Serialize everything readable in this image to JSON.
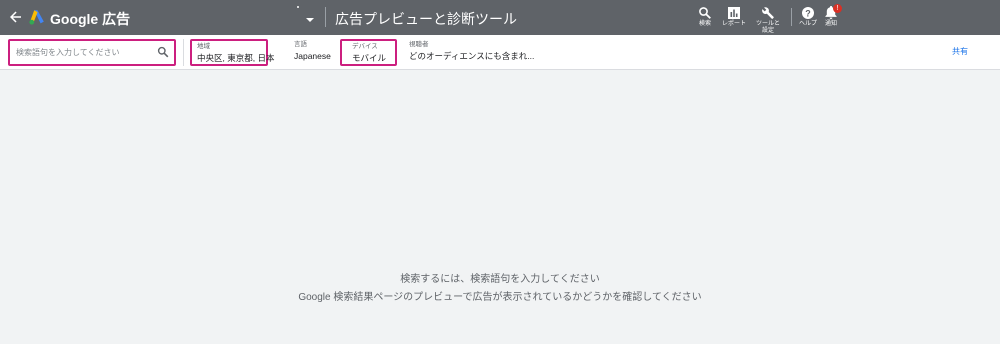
{
  "header": {
    "product": "Google 広告",
    "tool_title": "広告プレビューと診断ツール",
    "icons": [
      {
        "name": "search",
        "label": "検索"
      },
      {
        "name": "reports",
        "label": "レポート"
      },
      {
        "name": "tools",
        "label": "ツールと\n設定"
      },
      {
        "name": "help",
        "label": "ヘルプ"
      },
      {
        "name": "notifications",
        "label": "通知"
      }
    ],
    "notification_badge": "!"
  },
  "filters": {
    "search_placeholder": "検索語句を入力してください",
    "location": {
      "label": "地域",
      "value": "中央区, 東京都, 日本"
    },
    "language": {
      "label": "言語",
      "value": "Japanese"
    },
    "device": {
      "label": "デバイス",
      "value": "モバイル"
    },
    "audience": {
      "label": "視聴者",
      "value": "どのオーディエンスにも含まれ..."
    },
    "share": "共有"
  },
  "empty_state": {
    "line1": "検索するには、検索語句を入力してください",
    "line2": "Google 検索結果ページのプレビューで広告が表示されているかどうかを確認してください"
  },
  "colors": {
    "topbar": "#5f6368",
    "highlight": "#cc1f7f",
    "link": "#1a73e8",
    "background": "#f1f3f4",
    "badge": "#d93025"
  }
}
